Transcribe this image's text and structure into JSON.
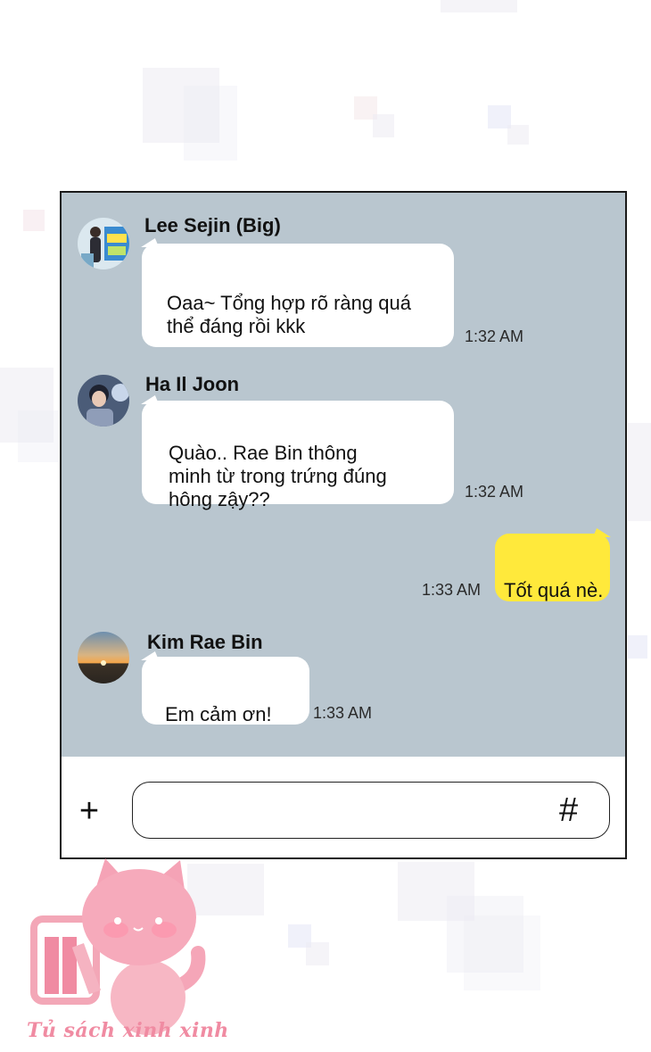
{
  "chat": {
    "messages": [
      {
        "sender": "Lee Sejin (Big)",
        "text": "Oaa~ Tổng hợp rõ ràng quá\nthể đáng rồi kkk",
        "time": "1:32 AM",
        "outgoing": false
      },
      {
        "sender": "Ha Il Joon",
        "text": "Quào.. Rae Bin thông\nminh từ trong trứng đúng\nhông zậy??",
        "time": "1:32 AM",
        "outgoing": false
      },
      {
        "sender": "",
        "text": "Tốt quá nè.",
        "time": "1:33 AM",
        "outgoing": true
      },
      {
        "sender": "Kim Rae Bin",
        "text": "Em cảm ơn!",
        "time": "1:33 AM",
        "outgoing": false
      }
    ]
  },
  "input_bar": {
    "plus_label": "+",
    "hash_label": "#",
    "value": "",
    "placeholder": ""
  },
  "watermark": {
    "text": "Tủ sách xinh xinh"
  },
  "colors": {
    "chat_background": "#b9c6cf",
    "incoming_bubble": "#ffffff",
    "outgoing_bubble": "#ffe93b",
    "watermark_pink": "#f08ba2"
  }
}
